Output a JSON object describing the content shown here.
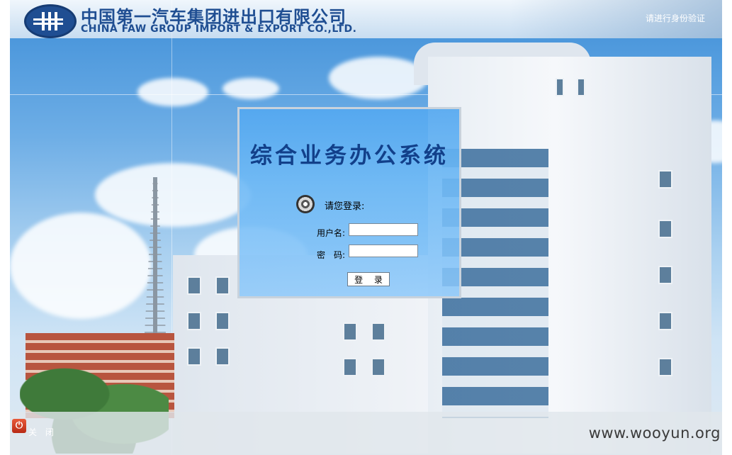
{
  "header": {
    "company_cn": "中国第一汽车集团进出口有限公司",
    "company_en": "CHINA FAW GROUP IMPORT & EXPORT CO.,LTD.",
    "verify_text": "请进行身份验证"
  },
  "login": {
    "system_title": "综合业务办公系统",
    "prompt": "请您登录:",
    "username_label": "用户名:",
    "username_value": "",
    "password_label": "密　码:",
    "password_value": "",
    "login_button": "登 录"
  },
  "footer": {
    "close_label": "关 闭",
    "watermark": "www.wooyun.org"
  },
  "icons": {
    "logo": "faw-logo-icon",
    "disc": "disc-icon",
    "close": "power-icon"
  },
  "colors": {
    "brand_blue": "#1f4e92",
    "panel_blue": "#54a8f0",
    "close_red": "#d8401f"
  }
}
